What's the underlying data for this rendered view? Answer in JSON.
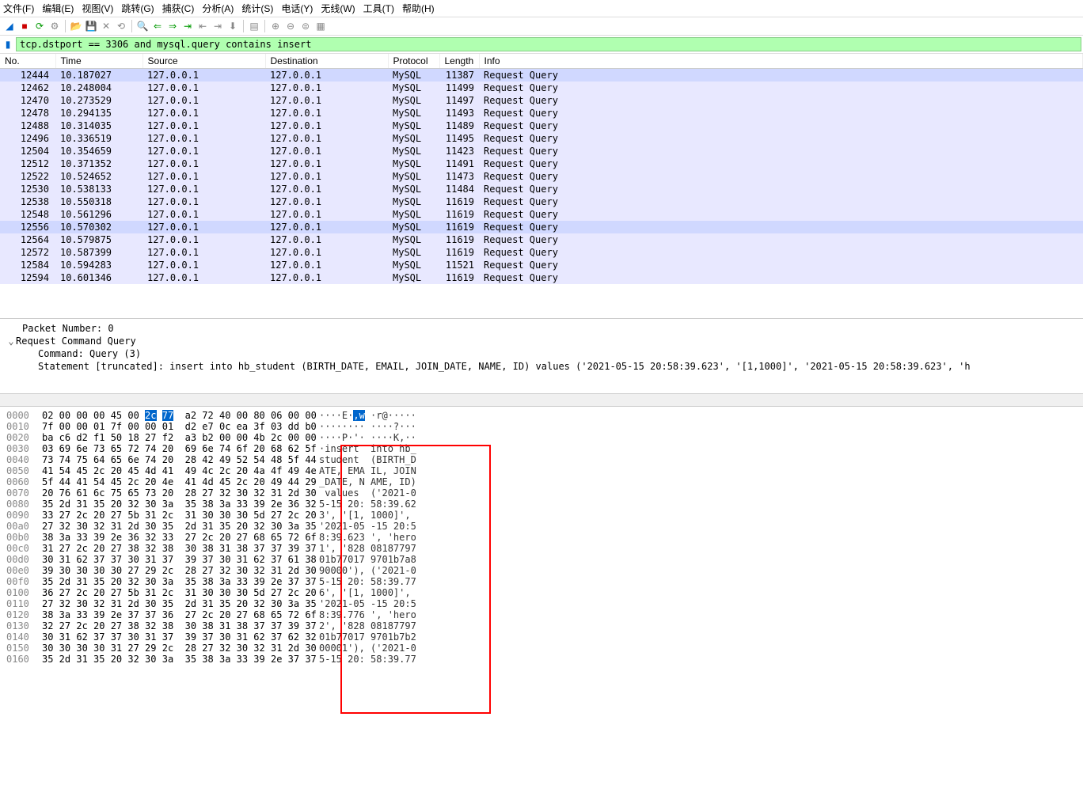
{
  "menu": {
    "file": "文件(F)",
    "edit": "编辑(E)",
    "view": "视图(V)",
    "go": "跳转(G)",
    "capture": "捕获(C)",
    "analyze": "分析(A)",
    "stats": "统计(S)",
    "telephony": "电话(Y)",
    "wireless": "无线(W)",
    "tools": "工具(T)",
    "help": "帮助(H)"
  },
  "filter": {
    "value": "tcp.dstport == 3306 and mysql.query contains insert"
  },
  "columns": {
    "no": "No.",
    "time": "Time",
    "source": "Source",
    "destination": "Destination",
    "protocol": "Protocol",
    "length": "Length",
    "info": "Info"
  },
  "packets": [
    {
      "no": "12444",
      "time": "10.187027",
      "src": "127.0.0.1",
      "dst": "127.0.0.1",
      "proto": "MySQL",
      "len": "11387",
      "info": "Request Query",
      "sel": true
    },
    {
      "no": "12462",
      "time": "10.248004",
      "src": "127.0.0.1",
      "dst": "127.0.0.1",
      "proto": "MySQL",
      "len": "11499",
      "info": "Request Query"
    },
    {
      "no": "12470",
      "time": "10.273529",
      "src": "127.0.0.1",
      "dst": "127.0.0.1",
      "proto": "MySQL",
      "len": "11497",
      "info": "Request Query"
    },
    {
      "no": "12478",
      "time": "10.294135",
      "src": "127.0.0.1",
      "dst": "127.0.0.1",
      "proto": "MySQL",
      "len": "11493",
      "info": "Request Query"
    },
    {
      "no": "12488",
      "time": "10.314035",
      "src": "127.0.0.1",
      "dst": "127.0.0.1",
      "proto": "MySQL",
      "len": "11489",
      "info": "Request Query"
    },
    {
      "no": "12496",
      "time": "10.336519",
      "src": "127.0.0.1",
      "dst": "127.0.0.1",
      "proto": "MySQL",
      "len": "11495",
      "info": "Request Query"
    },
    {
      "no": "12504",
      "time": "10.354659",
      "src": "127.0.0.1",
      "dst": "127.0.0.1",
      "proto": "MySQL",
      "len": "11423",
      "info": "Request Query"
    },
    {
      "no": "12512",
      "time": "10.371352",
      "src": "127.0.0.1",
      "dst": "127.0.0.1",
      "proto": "MySQL",
      "len": "11491",
      "info": "Request Query"
    },
    {
      "no": "12522",
      "time": "10.524652",
      "src": "127.0.0.1",
      "dst": "127.0.0.1",
      "proto": "MySQL",
      "len": "11473",
      "info": "Request Query"
    },
    {
      "no": "12530",
      "time": "10.538133",
      "src": "127.0.0.1",
      "dst": "127.0.0.1",
      "proto": "MySQL",
      "len": "11484",
      "info": "Request Query"
    },
    {
      "no": "12538",
      "time": "10.550318",
      "src": "127.0.0.1",
      "dst": "127.0.0.1",
      "proto": "MySQL",
      "len": "11619",
      "info": "Request Query"
    },
    {
      "no": "12548",
      "time": "10.561296",
      "src": "127.0.0.1",
      "dst": "127.0.0.1",
      "proto": "MySQL",
      "len": "11619",
      "info": "Request Query"
    },
    {
      "no": "12556",
      "time": "10.570302",
      "src": "127.0.0.1",
      "dst": "127.0.0.1",
      "proto": "MySQL",
      "len": "11619",
      "info": "Request Query",
      "sel": true
    },
    {
      "no": "12564",
      "time": "10.579875",
      "src": "127.0.0.1",
      "dst": "127.0.0.1",
      "proto": "MySQL",
      "len": "11619",
      "info": "Request Query"
    },
    {
      "no": "12572",
      "time": "10.587399",
      "src": "127.0.0.1",
      "dst": "127.0.0.1",
      "proto": "MySQL",
      "len": "11619",
      "info": "Request Query"
    },
    {
      "no": "12584",
      "time": "10.594283",
      "src": "127.0.0.1",
      "dst": "127.0.0.1",
      "proto": "MySQL",
      "len": "11521",
      "info": "Request Query"
    },
    {
      "no": "12594",
      "time": "10.601346",
      "src": "127.0.0.1",
      "dst": "127.0.0.1",
      "proto": "MySQL",
      "len": "11619",
      "info": "Request Query"
    }
  ],
  "details": {
    "packet_number": "Packet Number: 0",
    "request": "Request Command Query",
    "command": "Command: Query (3)",
    "statement": "Statement [truncated]: insert into hb_student (BIRTH_DATE, EMAIL, JOIN_DATE, NAME, ID) values ('2021-05-15 20:58:39.623', '[1,1000]', '2021-05-15 20:58:39.623', 'h"
  },
  "hex": [
    {
      "off": "0000",
      "b": "02 00 00 00 45 00 2c 77  a2 72 40 00 80 06 00 00",
      "a": "····E·,w ·r@·····",
      "hl": [
        6,
        7
      ],
      "ahl": [
        6,
        7
      ]
    },
    {
      "off": "0010",
      "b": "7f 00 00 01 7f 00 00 01  d2 e7 0c ea 3f 03 dd b0",
      "a": "········ ····?···"
    },
    {
      "off": "0020",
      "b": "ba c6 d2 f1 50 18 27 f2  a3 b2 00 00 4b 2c 00 00",
      "a": "····P·'· ····K,··"
    },
    {
      "off": "0030",
      "b": "03 69 6e 73 65 72 74 20  69 6e 74 6f 20 68 62 5f",
      "a": "·insert  into hb_"
    },
    {
      "off": "0040",
      "b": "73 74 75 64 65 6e 74 20  28 42 49 52 54 48 5f 44",
      "a": "student  (BIRTH_D"
    },
    {
      "off": "0050",
      "b": "41 54 45 2c 20 45 4d 41  49 4c 2c 20 4a 4f 49 4e",
      "a": "ATE, EMA IL, JOIN"
    },
    {
      "off": "0060",
      "b": "5f 44 41 54 45 2c 20 4e  41 4d 45 2c 20 49 44 29",
      "a": "_DATE, N AME, ID)"
    },
    {
      "off": "0070",
      "b": "20 76 61 6c 75 65 73 20  28 27 32 30 32 31 2d 30",
      "a": " values  ('2021-0"
    },
    {
      "off": "0080",
      "b": "35 2d 31 35 20 32 30 3a  35 38 3a 33 39 2e 36 32",
      "a": "5-15 20: 58:39.62"
    },
    {
      "off": "0090",
      "b": "33 27 2c 20 27 5b 31 2c  31 30 30 30 5d 27 2c 20",
      "a": "3', '[1, 1000]', "
    },
    {
      "off": "00a0",
      "b": "27 32 30 32 31 2d 30 35  2d 31 35 20 32 30 3a 35",
      "a": "'2021-05 -15 20:5"
    },
    {
      "off": "00b0",
      "b": "38 3a 33 39 2e 36 32 33  27 2c 20 27 68 65 72 6f",
      "a": "8:39.623 ', 'hero"
    },
    {
      "off": "00c0",
      "b": "31 27 2c 20 27 38 32 38  30 38 31 38 37 37 39 37",
      "a": "1', '828 08187797"
    },
    {
      "off": "00d0",
      "b": "30 31 62 37 37 30 31 37  39 37 30 31 62 37 61 38",
      "a": "01b77017 9701b7a8"
    },
    {
      "off": "00e0",
      "b": "39 30 30 30 30 27 29 2c  28 27 32 30 32 31 2d 30",
      "a": "90000'), ('2021-0"
    },
    {
      "off": "00f0",
      "b": "35 2d 31 35 20 32 30 3a  35 38 3a 33 39 2e 37 37",
      "a": "5-15 20: 58:39.77"
    },
    {
      "off": "0100",
      "b": "36 27 2c 20 27 5b 31 2c  31 30 30 30 5d 27 2c 20",
      "a": "6', '[1, 1000]', "
    },
    {
      "off": "0110",
      "b": "27 32 30 32 31 2d 30 35  2d 31 35 20 32 30 3a 35",
      "a": "'2021-05 -15 20:5"
    },
    {
      "off": "0120",
      "b": "38 3a 33 39 2e 37 37 36  27 2c 20 27 68 65 72 6f",
      "a": "8:39.776 ', 'hero"
    },
    {
      "off": "0130",
      "b": "32 27 2c 20 27 38 32 38  30 38 31 38 37 37 39 37",
      "a": "2', '828 08187797"
    },
    {
      "off": "0140",
      "b": "30 31 62 37 37 30 31 37  39 37 30 31 62 37 62 32",
      "a": "01b77017 9701b7b2"
    },
    {
      "off": "0150",
      "b": "30 30 30 30 31 27 29 2c  28 27 32 30 32 31 2d 30",
      "a": "00001'), ('2021-0"
    },
    {
      "off": "0160",
      "b": "35 2d 31 35 20 32 30 3a  35 38 3a 33 39 2e 37 37",
      "a": "5-15 20: 58:39.77"
    }
  ]
}
